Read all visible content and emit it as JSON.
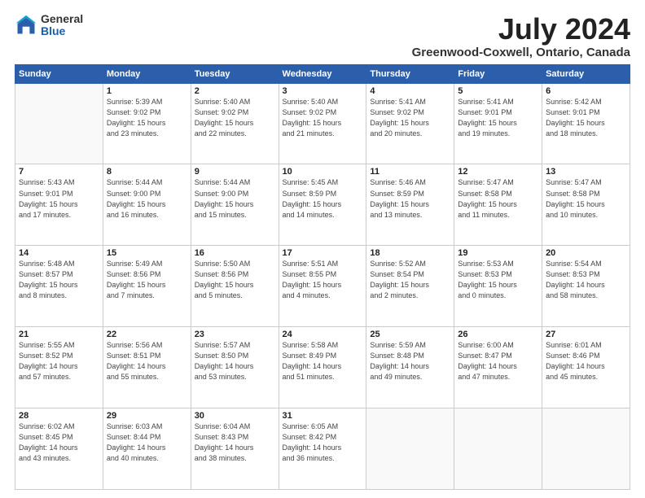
{
  "logo": {
    "general": "General",
    "blue": "Blue"
  },
  "title": {
    "month_year": "July 2024",
    "location": "Greenwood-Coxwell, Ontario, Canada"
  },
  "days_of_week": [
    "Sunday",
    "Monday",
    "Tuesday",
    "Wednesday",
    "Thursday",
    "Friday",
    "Saturday"
  ],
  "weeks": [
    [
      {
        "day": "",
        "info": ""
      },
      {
        "day": "1",
        "info": "Sunrise: 5:39 AM\nSunset: 9:02 PM\nDaylight: 15 hours\nand 23 minutes."
      },
      {
        "day": "2",
        "info": "Sunrise: 5:40 AM\nSunset: 9:02 PM\nDaylight: 15 hours\nand 22 minutes."
      },
      {
        "day": "3",
        "info": "Sunrise: 5:40 AM\nSunset: 9:02 PM\nDaylight: 15 hours\nand 21 minutes."
      },
      {
        "day": "4",
        "info": "Sunrise: 5:41 AM\nSunset: 9:02 PM\nDaylight: 15 hours\nand 20 minutes."
      },
      {
        "day": "5",
        "info": "Sunrise: 5:41 AM\nSunset: 9:01 PM\nDaylight: 15 hours\nand 19 minutes."
      },
      {
        "day": "6",
        "info": "Sunrise: 5:42 AM\nSunset: 9:01 PM\nDaylight: 15 hours\nand 18 minutes."
      }
    ],
    [
      {
        "day": "7",
        "info": "Sunrise: 5:43 AM\nSunset: 9:01 PM\nDaylight: 15 hours\nand 17 minutes."
      },
      {
        "day": "8",
        "info": "Sunrise: 5:44 AM\nSunset: 9:00 PM\nDaylight: 15 hours\nand 16 minutes."
      },
      {
        "day": "9",
        "info": "Sunrise: 5:44 AM\nSunset: 9:00 PM\nDaylight: 15 hours\nand 15 minutes."
      },
      {
        "day": "10",
        "info": "Sunrise: 5:45 AM\nSunset: 8:59 PM\nDaylight: 15 hours\nand 14 minutes."
      },
      {
        "day": "11",
        "info": "Sunrise: 5:46 AM\nSunset: 8:59 PM\nDaylight: 15 hours\nand 13 minutes."
      },
      {
        "day": "12",
        "info": "Sunrise: 5:47 AM\nSunset: 8:58 PM\nDaylight: 15 hours\nand 11 minutes."
      },
      {
        "day": "13",
        "info": "Sunrise: 5:47 AM\nSunset: 8:58 PM\nDaylight: 15 hours\nand 10 minutes."
      }
    ],
    [
      {
        "day": "14",
        "info": "Sunrise: 5:48 AM\nSunset: 8:57 PM\nDaylight: 15 hours\nand 8 minutes."
      },
      {
        "day": "15",
        "info": "Sunrise: 5:49 AM\nSunset: 8:56 PM\nDaylight: 15 hours\nand 7 minutes."
      },
      {
        "day": "16",
        "info": "Sunrise: 5:50 AM\nSunset: 8:56 PM\nDaylight: 15 hours\nand 5 minutes."
      },
      {
        "day": "17",
        "info": "Sunrise: 5:51 AM\nSunset: 8:55 PM\nDaylight: 15 hours\nand 4 minutes."
      },
      {
        "day": "18",
        "info": "Sunrise: 5:52 AM\nSunset: 8:54 PM\nDaylight: 15 hours\nand 2 minutes."
      },
      {
        "day": "19",
        "info": "Sunrise: 5:53 AM\nSunset: 8:53 PM\nDaylight: 15 hours\nand 0 minutes."
      },
      {
        "day": "20",
        "info": "Sunrise: 5:54 AM\nSunset: 8:53 PM\nDaylight: 14 hours\nand 58 minutes."
      }
    ],
    [
      {
        "day": "21",
        "info": "Sunrise: 5:55 AM\nSunset: 8:52 PM\nDaylight: 14 hours\nand 57 minutes."
      },
      {
        "day": "22",
        "info": "Sunrise: 5:56 AM\nSunset: 8:51 PM\nDaylight: 14 hours\nand 55 minutes."
      },
      {
        "day": "23",
        "info": "Sunrise: 5:57 AM\nSunset: 8:50 PM\nDaylight: 14 hours\nand 53 minutes."
      },
      {
        "day": "24",
        "info": "Sunrise: 5:58 AM\nSunset: 8:49 PM\nDaylight: 14 hours\nand 51 minutes."
      },
      {
        "day": "25",
        "info": "Sunrise: 5:59 AM\nSunset: 8:48 PM\nDaylight: 14 hours\nand 49 minutes."
      },
      {
        "day": "26",
        "info": "Sunrise: 6:00 AM\nSunset: 8:47 PM\nDaylight: 14 hours\nand 47 minutes."
      },
      {
        "day": "27",
        "info": "Sunrise: 6:01 AM\nSunset: 8:46 PM\nDaylight: 14 hours\nand 45 minutes."
      }
    ],
    [
      {
        "day": "28",
        "info": "Sunrise: 6:02 AM\nSunset: 8:45 PM\nDaylight: 14 hours\nand 43 minutes."
      },
      {
        "day": "29",
        "info": "Sunrise: 6:03 AM\nSunset: 8:44 PM\nDaylight: 14 hours\nand 40 minutes."
      },
      {
        "day": "30",
        "info": "Sunrise: 6:04 AM\nSunset: 8:43 PM\nDaylight: 14 hours\nand 38 minutes."
      },
      {
        "day": "31",
        "info": "Sunrise: 6:05 AM\nSunset: 8:42 PM\nDaylight: 14 hours\nand 36 minutes."
      },
      {
        "day": "",
        "info": ""
      },
      {
        "day": "",
        "info": ""
      },
      {
        "day": "",
        "info": ""
      }
    ]
  ]
}
